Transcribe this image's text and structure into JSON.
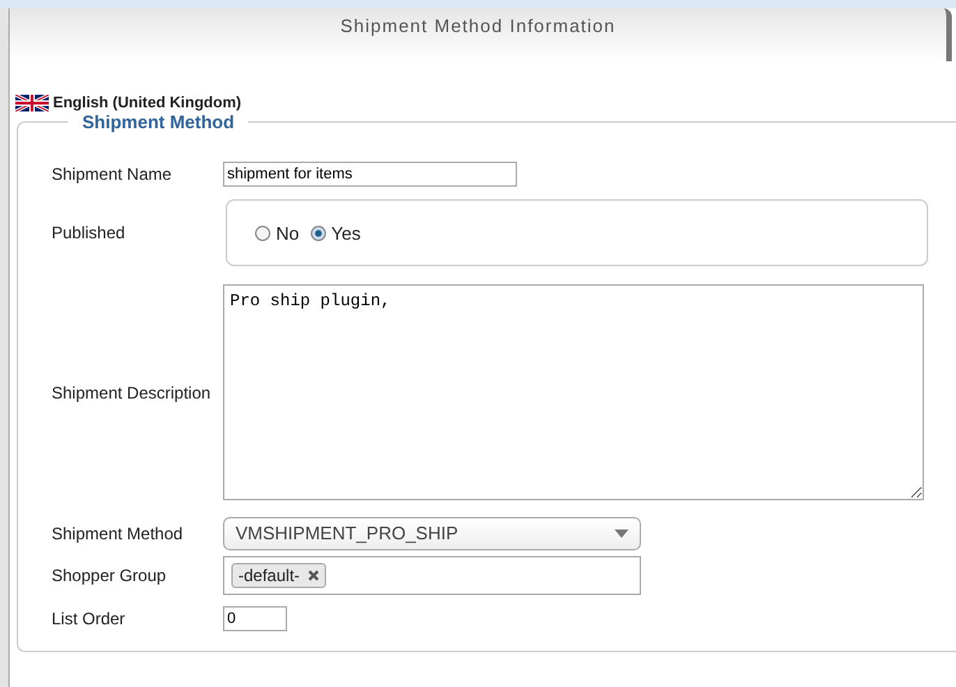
{
  "panel": {
    "title": "Shipment Method Information"
  },
  "language": {
    "label": "English (United Kingdom)"
  },
  "fieldset": {
    "legend": "Shipment Method",
    "rows": [
      {
        "kind": "text",
        "label": "Shipment Name",
        "value": "shipment for items"
      },
      {
        "kind": "radio",
        "label": "Published",
        "options": [
          {
            "label": "No",
            "selected": false
          },
          {
            "label": "Yes",
            "selected": true
          }
        ]
      },
      {
        "kind": "textarea",
        "label": "Shipment Description",
        "value": "Pro ship plugin,"
      },
      {
        "kind": "select",
        "label": "Shipment Method",
        "value": "VMSHIPMENT_PRO_SHIP"
      },
      {
        "kind": "tags",
        "label": "Shopper Group",
        "tags": [
          "-default-"
        ]
      },
      {
        "kind": "small",
        "label": "List Order",
        "value": "0"
      }
    ]
  }
}
